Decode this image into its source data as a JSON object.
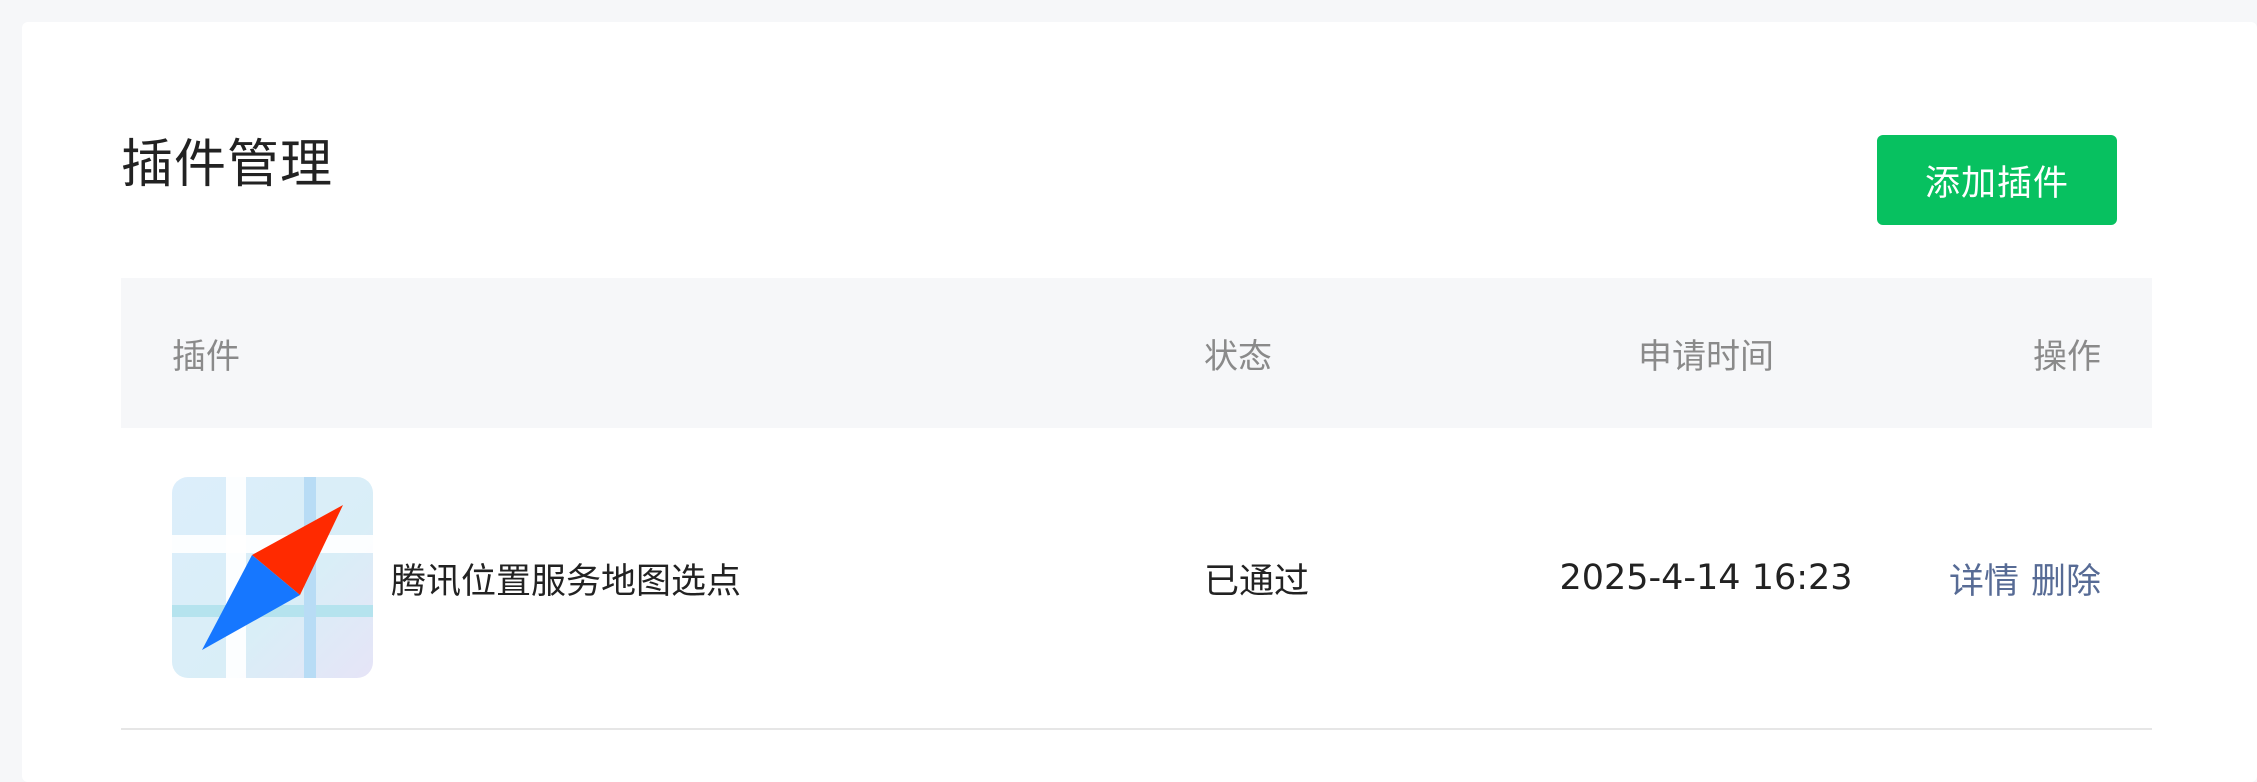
{
  "page": {
    "title": "插件管理",
    "add_button_label": "添加插件"
  },
  "table": {
    "headers": {
      "plugin": "插件",
      "status": "状态",
      "apply_time": "申请时间",
      "actions": "操作"
    },
    "rows": [
      {
        "icon": "tencent-map-compass-icon",
        "name": "腾讯位置服务地图选点",
        "status": "已通过",
        "apply_time": "2025-4-14 16:23",
        "detail_label": "详情",
        "delete_label": "删除"
      }
    ]
  },
  "colors": {
    "primary_button": "#07c160",
    "link": "#576b95",
    "header_bg": "#f6f7f9"
  }
}
